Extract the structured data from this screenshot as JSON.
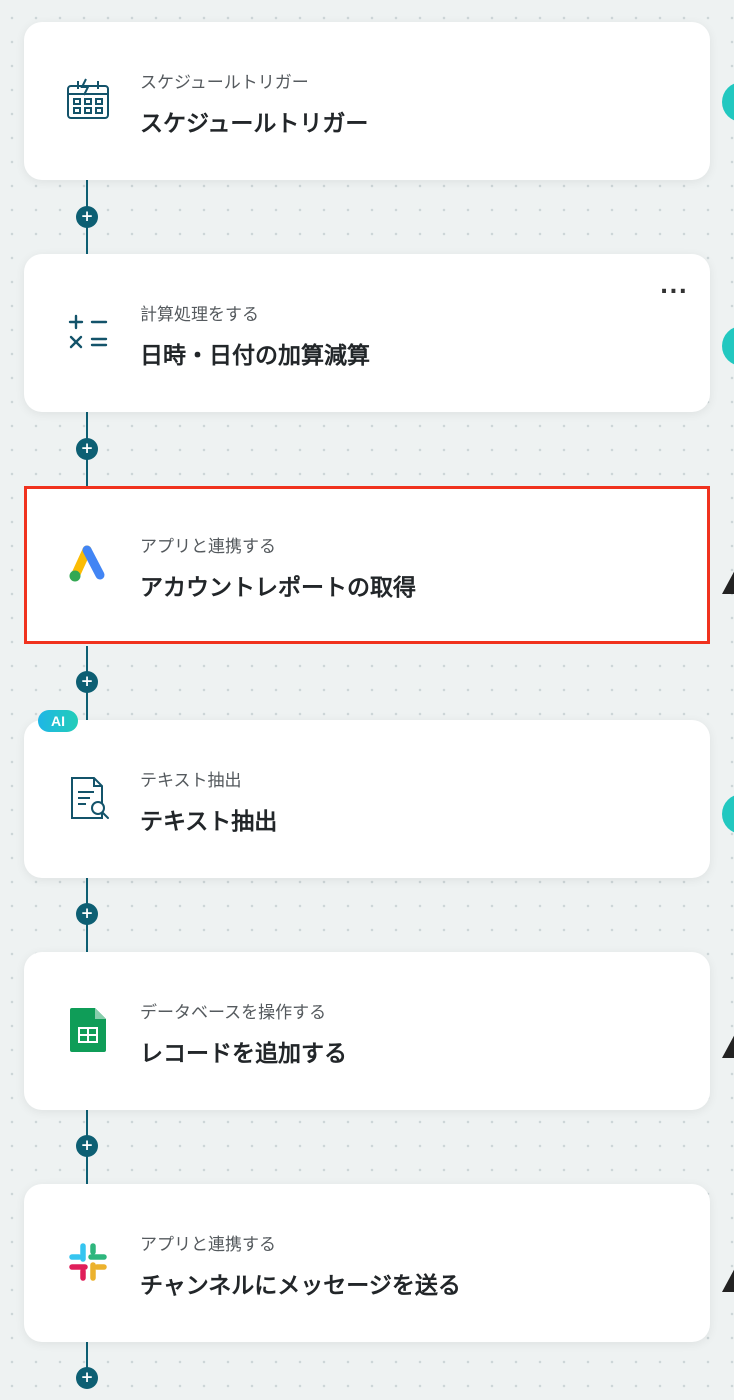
{
  "steps": [
    {
      "subtitle": "スケジュールトリガー",
      "title": "スケジュールトリガー",
      "icon": "schedule-calendar-icon"
    },
    {
      "subtitle": "計算処理をする",
      "title": "日時・日付の加算減算",
      "icon": "math-operators-icon",
      "menu": "..."
    },
    {
      "subtitle": "アプリと連携する",
      "title": "アカウントレポートの取得",
      "icon": "google-ads-icon",
      "selected": true
    },
    {
      "subtitle": "テキスト抽出",
      "title": "テキスト抽出",
      "icon": "document-search-icon",
      "badge": "AI"
    },
    {
      "subtitle": "データベースを操作する",
      "title": "レコードを追加する",
      "icon": "google-sheets-icon"
    },
    {
      "subtitle": "アプリと連携する",
      "title": "チャンネルにメッセージを送る",
      "icon": "slack-icon"
    }
  ],
  "add_button_symbol": "+",
  "colors": {
    "accent": "#0d5f73",
    "selection_border": "#f0321e",
    "ai_badge_start": "#1fb6e6",
    "ai_badge_end": "#22cdb8",
    "side_indicator": "#22c8c0"
  }
}
